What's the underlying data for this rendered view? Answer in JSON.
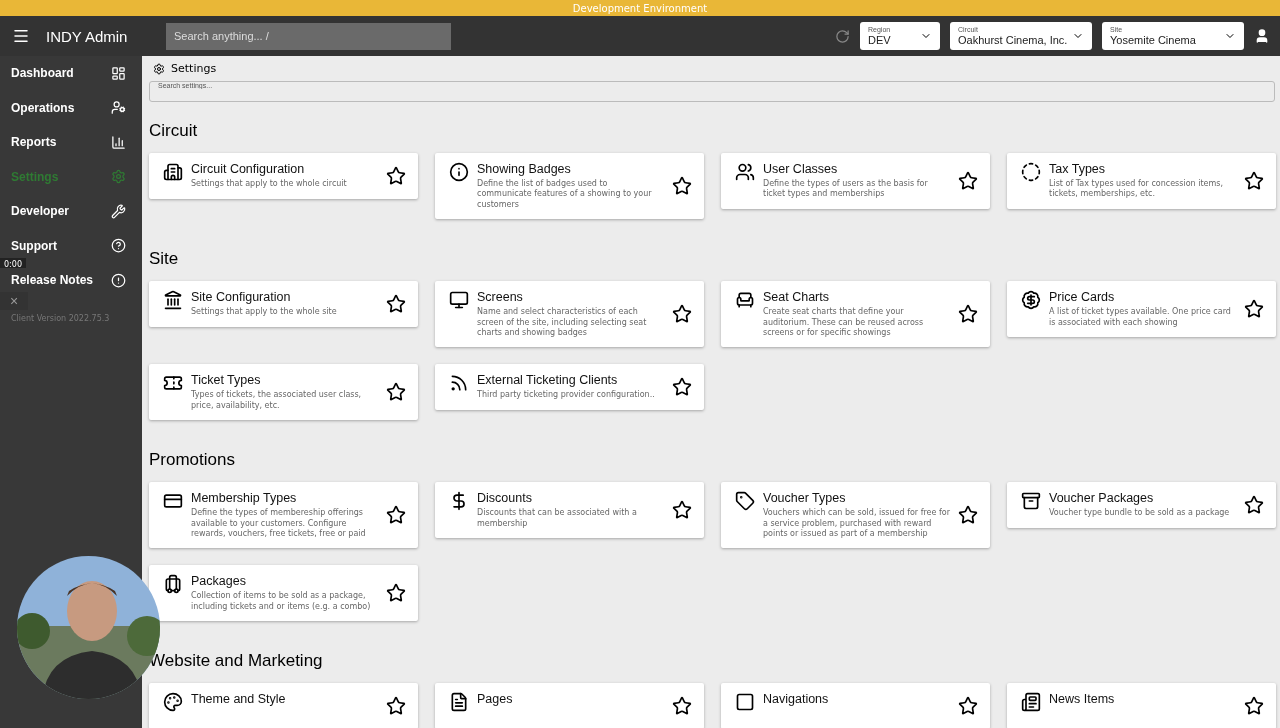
{
  "banner": "Development Environment",
  "app_title": "INDY Admin",
  "search": {
    "placeholder": "Search anything... /"
  },
  "selectors": [
    {
      "label": "Region",
      "value": "DEV"
    },
    {
      "label": "Circuit",
      "value": "Oakhurst Cinema, Inc."
    },
    {
      "label": "Site",
      "value": "Yosemite Cinema"
    }
  ],
  "sidebar": {
    "items": [
      {
        "label": "Dashboard",
        "selected": false
      },
      {
        "label": "Operations",
        "selected": false
      },
      {
        "label": "Reports",
        "selected": false
      },
      {
        "label": "Settings",
        "selected": true
      },
      {
        "label": "Developer",
        "selected": false
      },
      {
        "label": "Support",
        "selected": false
      },
      {
        "label": "Release Notes",
        "selected": false
      }
    ],
    "version": "Client Version 2022.75.3"
  },
  "video_overlay": {
    "timer": "0:00",
    "close": "×"
  },
  "breadcrumb": "Settings",
  "settings_search": {
    "placeholder": "Search settings..."
  },
  "sections": [
    {
      "title": "Circuit",
      "cards": [
        {
          "title": "Circuit Configuration",
          "description": "Settings that apply to the whole circuit"
        },
        {
          "title": "Showing Badges",
          "description": "Define the list of badges used to communicate features of a showing to your customers"
        },
        {
          "title": "User Classes",
          "description": "Define the types of users as the basis for ticket types and memberships"
        },
        {
          "title": "Tax Types",
          "description": "List of Tax types used for concession items, tickets, memberships, etc."
        }
      ]
    },
    {
      "title": "Site",
      "cards": [
        {
          "title": "Site Configuration",
          "description": "Settings that apply to the whole site"
        },
        {
          "title": "Screens",
          "description": "Name and select characteristics of each screen of the site, including selecting seat charts and showing badges"
        },
        {
          "title": "Seat Charts",
          "description": "Create seat charts that define your auditorium. These can be reused across screens or for specific showings"
        },
        {
          "title": "Price Cards",
          "description": "A list of ticket types available. One price card is associated with each showing"
        },
        {
          "title": "Ticket Types",
          "description": "Types of tickets, the associated user class, price, availability, etc."
        },
        {
          "title": "External Ticketing Clients",
          "description": "Third party ticketing provider configuration.."
        }
      ]
    },
    {
      "title": "Promotions",
      "cards": [
        {
          "title": "Membership Types",
          "description": "Define the types of membereship offerings available to your customers. Configure rewards, vouchers, free tickets, free or paid"
        },
        {
          "title": "Discounts",
          "description": "Discounts that can be associated with a membership"
        },
        {
          "title": "Voucher Types",
          "description": "Vouchers which can be sold, issued for free for a service problem, purchased with reward points or issued as part of a membership"
        },
        {
          "title": "Voucher Packages",
          "description": "Voucher type bundle to be sold as a package"
        },
        {
          "title": "Packages",
          "description": "Collection of items to be sold as a package, including tickets and or items (e.g. a combo)"
        }
      ]
    },
    {
      "title": "Website and Marketing",
      "cards": [
        {
          "title": "Theme and Style"
        },
        {
          "title": "Pages"
        },
        {
          "title": "Navigations"
        },
        {
          "title": "News Items"
        }
      ]
    }
  ]
}
